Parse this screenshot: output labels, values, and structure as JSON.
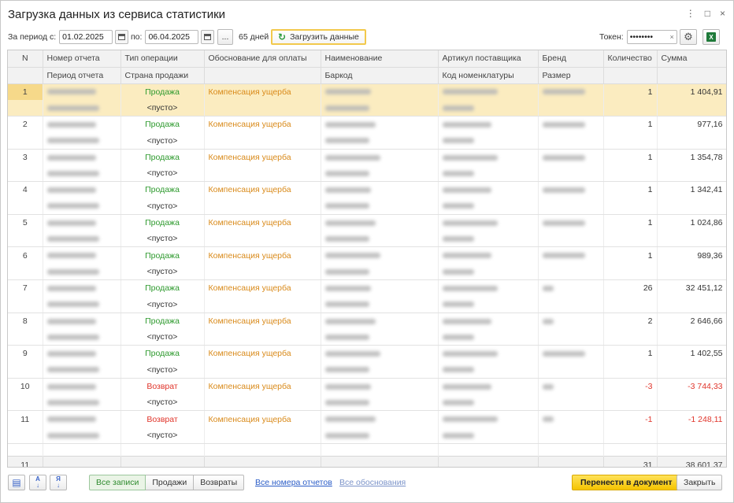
{
  "window": {
    "title": "Загрузка данных из сервиса статистики",
    "controls": {
      "menu": "⋮",
      "maximize": "□",
      "close": "×"
    }
  },
  "toolbar": {
    "period_from_label": "За период с:",
    "period_from_value": "01.02.2025",
    "period_to_label": "по:",
    "period_to_value": "06.04.2025",
    "dots_label": "...",
    "days_count": "65 дней",
    "load_button_label": "Загрузить данные",
    "token_label": "Токен:",
    "token_value": "••••••••",
    "token_clear": "×"
  },
  "table": {
    "headers_row1": [
      "N",
      "Номер отчета",
      "Тип операции",
      "Обоснование для оплаты",
      "Наименование",
      "Артикул поставщика",
      "Бренд",
      "Количество",
      "Сумма"
    ],
    "headers_row2": [
      "",
      "Период отчета",
      "Страна продажи",
      "",
      "Баркод",
      "Код номенклатуры",
      "Размер",
      "",
      ""
    ],
    "rows": [
      {
        "n": "1",
        "op": "Продажа",
        "country": "<пусто>",
        "reason": "Компенсация ущерба",
        "qty": "1",
        "sum": "1 404,91",
        "selected": true
      },
      {
        "n": "2",
        "op": "Продажа",
        "country": "<пусто>",
        "reason": "Компенсация ущерба",
        "qty": "1",
        "sum": "977,16"
      },
      {
        "n": "3",
        "op": "Продажа",
        "country": "<пусто>",
        "reason": "Компенсация ущерба",
        "qty": "1",
        "sum": "1 354,78"
      },
      {
        "n": "4",
        "op": "Продажа",
        "country": "<пусто>",
        "reason": "Компенсация ущерба",
        "qty": "1",
        "sum": "1 342,41"
      },
      {
        "n": "5",
        "op": "Продажа",
        "country": "<пусто>",
        "reason": "Компенсация ущерба",
        "qty": "1",
        "sum": "1 024,86"
      },
      {
        "n": "6",
        "op": "Продажа",
        "country": "<пусто>",
        "reason": "Компенсация ущерба",
        "qty": "1",
        "sum": "989,36"
      },
      {
        "n": "7",
        "op": "Продажа",
        "country": "<пусто>",
        "reason": "Компенсация ущерба",
        "qty": "26",
        "sum": "32 451,12"
      },
      {
        "n": "8",
        "op": "Продажа",
        "country": "<пусто>",
        "reason": "Компенсация ущерба",
        "qty": "2",
        "sum": "2 646,66"
      },
      {
        "n": "9",
        "op": "Продажа",
        "country": "<пусто>",
        "reason": "Компенсация ущерба",
        "qty": "1",
        "sum": "1 402,55"
      },
      {
        "n": "10",
        "op": "Возврат",
        "country": "<пусто>",
        "reason": "Компенсация ущерба",
        "qty": "-3",
        "sum": "-3 744,33"
      },
      {
        "n": "11",
        "op": "Возврат",
        "country": "<пусто>",
        "reason": "Компенсация ущерба",
        "qty": "-1",
        "sum": "-1 248,11"
      }
    ],
    "footer": {
      "count": "11",
      "qty_total": "31",
      "sum_total": "38 601,37"
    }
  },
  "bottom": {
    "filters": [
      "Все записи",
      "Продажи",
      "Возвраты"
    ],
    "link_reports": "Все номера отчетов",
    "link_reasons": "Все обоснования",
    "transfer_button": "Перенести в документ",
    "close_button": "Закрыть"
  },
  "colors": {
    "sale": "#2e9a2e",
    "return": "#e0352b",
    "reason": "#d98a1a",
    "selected_row": "#fbecc0",
    "primary_button": "#f5c400"
  }
}
